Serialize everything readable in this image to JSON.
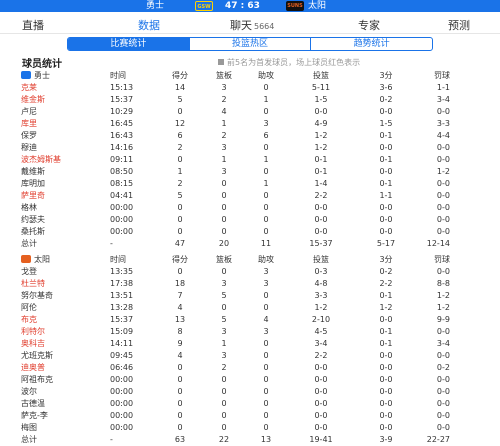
{
  "header": {
    "home_team": "勇士",
    "home_logo": "GSW",
    "score": "47 : 63",
    "away_logo": "SUNS",
    "away_team": "太阳"
  },
  "tabs": [
    {
      "label": "直播"
    },
    {
      "label": "数据"
    },
    {
      "label": "聊天",
      "count": "5664"
    },
    {
      "label": "专家"
    },
    {
      "label": "预测"
    }
  ],
  "segments": [
    "比赛统计",
    "投篮热区",
    "趋势统计"
  ],
  "section": {
    "title": "球员统计",
    "note": "前5名为首发球员，场上球员红色表示"
  },
  "columns": [
    "时间",
    "得分",
    "篮板",
    "助攻",
    "投篮",
    "3分",
    "罚球"
  ],
  "colors": {
    "accent": "#1a73e8",
    "on_court": "#e03c2c"
  },
  "team1": {
    "name": "勇士",
    "players": [
      {
        "name": "克莱",
        "min": "15:13",
        "pts": "14",
        "reb": "3",
        "ast": "0",
        "fg": "5-11",
        "tp": "3-6",
        "ft": "1-1",
        "on_court": true
      },
      {
        "name": "维金斯",
        "min": "15:37",
        "pts": "5",
        "reb": "2",
        "ast": "1",
        "fg": "1-5",
        "tp": "0-2",
        "ft": "3-4",
        "on_court": true
      },
      {
        "name": "卢尼",
        "min": "10:29",
        "pts": "0",
        "reb": "4",
        "ast": "0",
        "fg": "0-0",
        "tp": "0-0",
        "ft": "0-0",
        "on_court": false
      },
      {
        "name": "库里",
        "min": "16:45",
        "pts": "12",
        "reb": "1",
        "ast": "3",
        "fg": "4-9",
        "tp": "1-5",
        "ft": "3-3",
        "on_court": true
      },
      {
        "name": "保罗",
        "min": "16:43",
        "pts": "6",
        "reb": "2",
        "ast": "6",
        "fg": "1-2",
        "tp": "0-1",
        "ft": "4-4",
        "on_court": false
      },
      {
        "name": "穆迪",
        "min": "14:16",
        "pts": "2",
        "reb": "3",
        "ast": "0",
        "fg": "1-2",
        "tp": "0-0",
        "ft": "0-0",
        "on_court": false
      },
      {
        "name": "波杰姆斯基",
        "min": "09:11",
        "pts": "0",
        "reb": "1",
        "ast": "1",
        "fg": "0-1",
        "tp": "0-1",
        "ft": "0-0",
        "on_court": true
      },
      {
        "name": "戴维斯",
        "min": "08:50",
        "pts": "1",
        "reb": "3",
        "ast": "0",
        "fg": "0-1",
        "tp": "0-0",
        "ft": "1-2",
        "on_court": false
      },
      {
        "name": "库明加",
        "min": "08:15",
        "pts": "2",
        "reb": "0",
        "ast": "1",
        "fg": "1-4",
        "tp": "0-1",
        "ft": "0-0",
        "on_court": false
      },
      {
        "name": "萨里奇",
        "min": "04:41",
        "pts": "5",
        "reb": "0",
        "ast": "0",
        "fg": "2-2",
        "tp": "1-1",
        "ft": "0-0",
        "on_court": true
      },
      {
        "name": "格林",
        "min": "00:00",
        "pts": "0",
        "reb": "0",
        "ast": "0",
        "fg": "0-0",
        "tp": "0-0",
        "ft": "0-0",
        "on_court": false
      },
      {
        "name": "约瑟夫",
        "min": "00:00",
        "pts": "0",
        "reb": "0",
        "ast": "0",
        "fg": "0-0",
        "tp": "0-0",
        "ft": "0-0",
        "on_court": false
      },
      {
        "name": "桑托斯",
        "min": "00:00",
        "pts": "0",
        "reb": "0",
        "ast": "0",
        "fg": "0-0",
        "tp": "0-0",
        "ft": "0-0",
        "on_court": false
      }
    ],
    "total": {
      "name": "总计",
      "min": "-",
      "pts": "47",
      "reb": "20",
      "ast": "11",
      "fg": "15-37",
      "tp": "5-17",
      "ft": "12-14"
    }
  },
  "team2": {
    "name": "太阳",
    "players": [
      {
        "name": "戈登",
        "min": "13:35",
        "pts": "0",
        "reb": "0",
        "ast": "3",
        "fg": "0-3",
        "tp": "0-2",
        "ft": "0-0",
        "on_court": false
      },
      {
        "name": "杜兰特",
        "min": "17:38",
        "pts": "18",
        "reb": "3",
        "ast": "3",
        "fg": "4-8",
        "tp": "2-2",
        "ft": "8-8",
        "on_court": true
      },
      {
        "name": "努尔基奇",
        "min": "13:51",
        "pts": "7",
        "reb": "5",
        "ast": "0",
        "fg": "3-3",
        "tp": "0-1",
        "ft": "1-2",
        "on_court": false
      },
      {
        "name": "阿伦",
        "min": "13:28",
        "pts": "4",
        "reb": "0",
        "ast": "0",
        "fg": "1-2",
        "tp": "1-2",
        "ft": "1-2",
        "on_court": false
      },
      {
        "name": "布克",
        "min": "15:37",
        "pts": "13",
        "reb": "5",
        "ast": "4",
        "fg": "2-10",
        "tp": "0-0",
        "ft": "9-9",
        "on_court": true
      },
      {
        "name": "利特尔",
        "min": "15:09",
        "pts": "8",
        "reb": "3",
        "ast": "3",
        "fg": "4-5",
        "tp": "0-1",
        "ft": "0-0",
        "on_court": true
      },
      {
        "name": "奥科吉",
        "min": "14:11",
        "pts": "9",
        "reb": "1",
        "ast": "0",
        "fg": "3-4",
        "tp": "0-1",
        "ft": "3-4",
        "on_court": true
      },
      {
        "name": "尤班克斯",
        "min": "09:45",
        "pts": "4",
        "reb": "3",
        "ast": "0",
        "fg": "2-2",
        "tp": "0-0",
        "ft": "0-0",
        "on_court": false
      },
      {
        "name": "迪奥普",
        "min": "06:46",
        "pts": "0",
        "reb": "2",
        "ast": "0",
        "fg": "0-0",
        "tp": "0-0",
        "ft": "0-2",
        "on_court": true
      },
      {
        "name": "阿祖布克",
        "min": "00:00",
        "pts": "0",
        "reb": "0",
        "ast": "0",
        "fg": "0-0",
        "tp": "0-0",
        "ft": "0-0",
        "on_court": false
      },
      {
        "name": "波尔",
        "min": "00:00",
        "pts": "0",
        "reb": "0",
        "ast": "0",
        "fg": "0-0",
        "tp": "0-0",
        "ft": "0-0",
        "on_court": false
      },
      {
        "name": "古德温",
        "min": "00:00",
        "pts": "0",
        "reb": "0",
        "ast": "0",
        "fg": "0-0",
        "tp": "0-0",
        "ft": "0-0",
        "on_court": false
      },
      {
        "name": "萨克-李",
        "min": "00:00",
        "pts": "0",
        "reb": "0",
        "ast": "0",
        "fg": "0-0",
        "tp": "0-0",
        "ft": "0-0",
        "on_court": false
      },
      {
        "name": "梅图",
        "min": "00:00",
        "pts": "0",
        "reb": "0",
        "ast": "0",
        "fg": "0-0",
        "tp": "0-0",
        "ft": "0-0",
        "on_court": false
      }
    ],
    "total": {
      "name": "总计",
      "min": "-",
      "pts": "63",
      "reb": "22",
      "ast": "13",
      "fg": "19-41",
      "tp": "3-9",
      "ft": "22-27"
    }
  }
}
